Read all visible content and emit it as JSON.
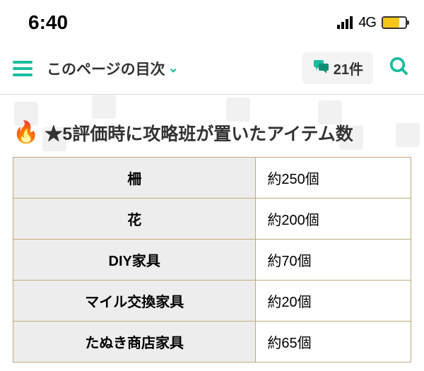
{
  "status": {
    "time": "6:40",
    "net": "4G"
  },
  "nav": {
    "toc_label": "このページの目次",
    "comment_count": "21件"
  },
  "heading": "★5評価時に攻略班が置いたアイテム数",
  "rows": [
    {
      "name": "柵",
      "value": "約250個"
    },
    {
      "name": "花",
      "value": "約200個"
    },
    {
      "name": "DIY家具",
      "value": "約70個"
    },
    {
      "name": "マイル交換家具",
      "value": "約20個"
    },
    {
      "name": "たぬき商店家具",
      "value": "約65個"
    }
  ]
}
